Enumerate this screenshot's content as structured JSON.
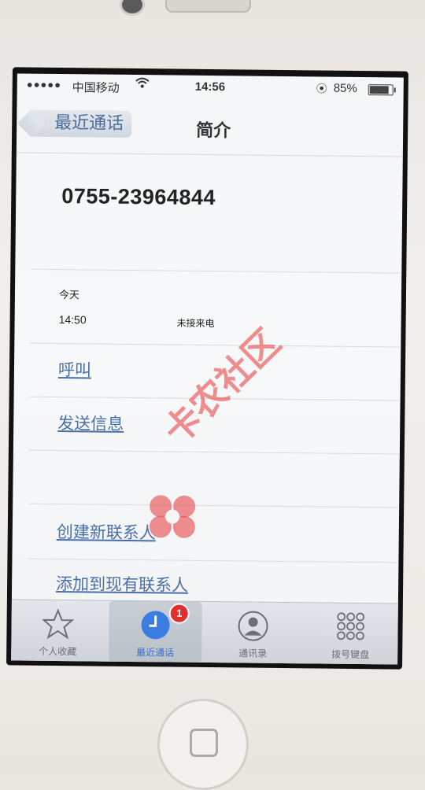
{
  "status_bar": {
    "signal_dots": "●●●●●",
    "carrier": "中国移动",
    "time": "14:56",
    "battery_percent": "85%",
    "battery_level": 0.85
  },
  "nav": {
    "back_label": "最近通话",
    "title": "简介"
  },
  "contact": {
    "phone_number": "0755-23964844"
  },
  "call_log": {
    "day": "今天",
    "time": "14:50",
    "type": "未接来电"
  },
  "actions": {
    "call": "呼叫",
    "send_message": "发送信息",
    "create_contact": "创建新联系人",
    "add_to_existing": "添加到现有联系人"
  },
  "watermark": {
    "text": "卡农社区"
  },
  "tabs": [
    {
      "label": "个人收藏",
      "icon": "star-icon",
      "active": false
    },
    {
      "label": "最近通话",
      "icon": "clock-icon",
      "active": true,
      "badge": "1"
    },
    {
      "label": "通讯录",
      "icon": "contacts-icon",
      "active": false
    },
    {
      "label": "拨号键盘",
      "icon": "keypad-icon",
      "active": false
    }
  ],
  "colors": {
    "link_blue": "#4a6fa8",
    "active_tab": "#3b6fd0",
    "badge_red": "#e52e2e",
    "watermark_red": "#e84646"
  }
}
